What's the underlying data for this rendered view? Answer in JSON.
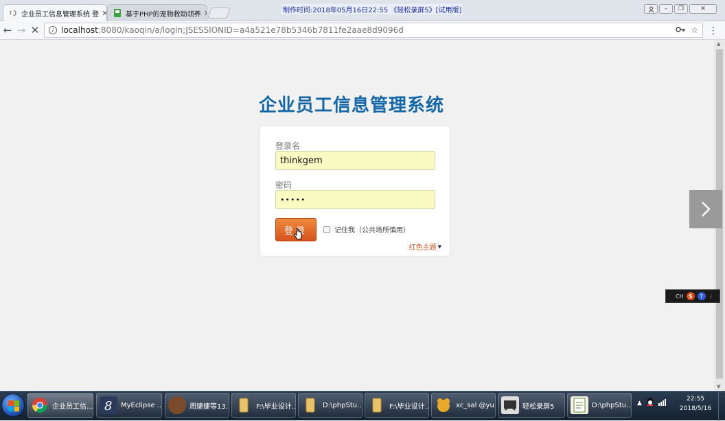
{
  "browser": {
    "tabs": [
      {
        "title": "企业员工信息管理系统 登",
        "active": true
      },
      {
        "title": "基于PHP的宠物救助领养",
        "active": false
      }
    ],
    "record_banner": "制作时间:2018年05月16日22:55 《轻松录屏5》[试用版]",
    "url_host": "localhost",
    "url_rest": ":8080/kaoqin/a/login;JSESSIONID=a4a521e78b5346b7811fe2aae8d9096d",
    "colors": {
      "accent": "#1366a8",
      "login_button": "#e0621f"
    }
  },
  "login": {
    "system_title": "企业员工信息管理系统",
    "username_label": "登录名",
    "username_value": "thinkgem",
    "password_label": "密码",
    "password_value": "•••••",
    "login_button": "登录",
    "remember_label": "记住我（公共场所慎用）",
    "theme_label": "红色主题"
  },
  "ime": {
    "label": "CH",
    "sogou": "S",
    "help": "?"
  },
  "taskbar": {
    "items": [
      {
        "label": "企业员工信...",
        "icon": "chrome-icon",
        "active": true
      },
      {
        "label": "MyEclipse ...",
        "icon": "myeclipse-icon",
        "active": false
      },
      {
        "label": "周婕婕等13...",
        "icon": "avatar-icon",
        "active": false
      },
      {
        "label": "F:\\毕业设计...",
        "icon": "folder-icon",
        "active": false
      },
      {
        "label": "D:\\phpStu...",
        "icon": "folder-icon",
        "active": false
      },
      {
        "label": "F:\\毕业设计...",
        "icon": "folder-icon",
        "active": false
      },
      {
        "label": "xc_sal @yu...",
        "icon": "navicat-icon",
        "active": false
      },
      {
        "label": "轻松录屏5",
        "icon": "recorder-icon",
        "active": false
      },
      {
        "label": "D:\\phpStu...",
        "icon": "notepad-icon",
        "active": false
      }
    ],
    "clock_time": "22:55",
    "clock_date": "2018/5/16"
  }
}
